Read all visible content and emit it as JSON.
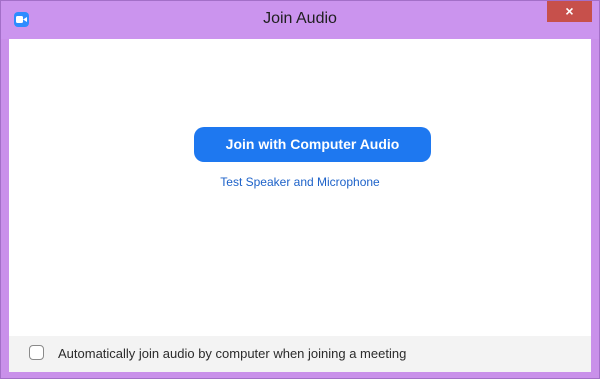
{
  "window": {
    "title": "Join Audio",
    "close_label": "×"
  },
  "main": {
    "join_button_label": "Join with Computer Audio",
    "test_link_label": "Test Speaker and Microphone"
  },
  "footer": {
    "auto_join_checked": false,
    "auto_join_label": "Automatically join audio by computer when joining a meeting"
  },
  "colors": {
    "titlebar": "#cb94ee",
    "accent": "#1e78f0",
    "link": "#1d62c9",
    "close": "#c7504b"
  },
  "icons": {
    "app": "zoom-camera-icon",
    "close": "close-icon"
  }
}
